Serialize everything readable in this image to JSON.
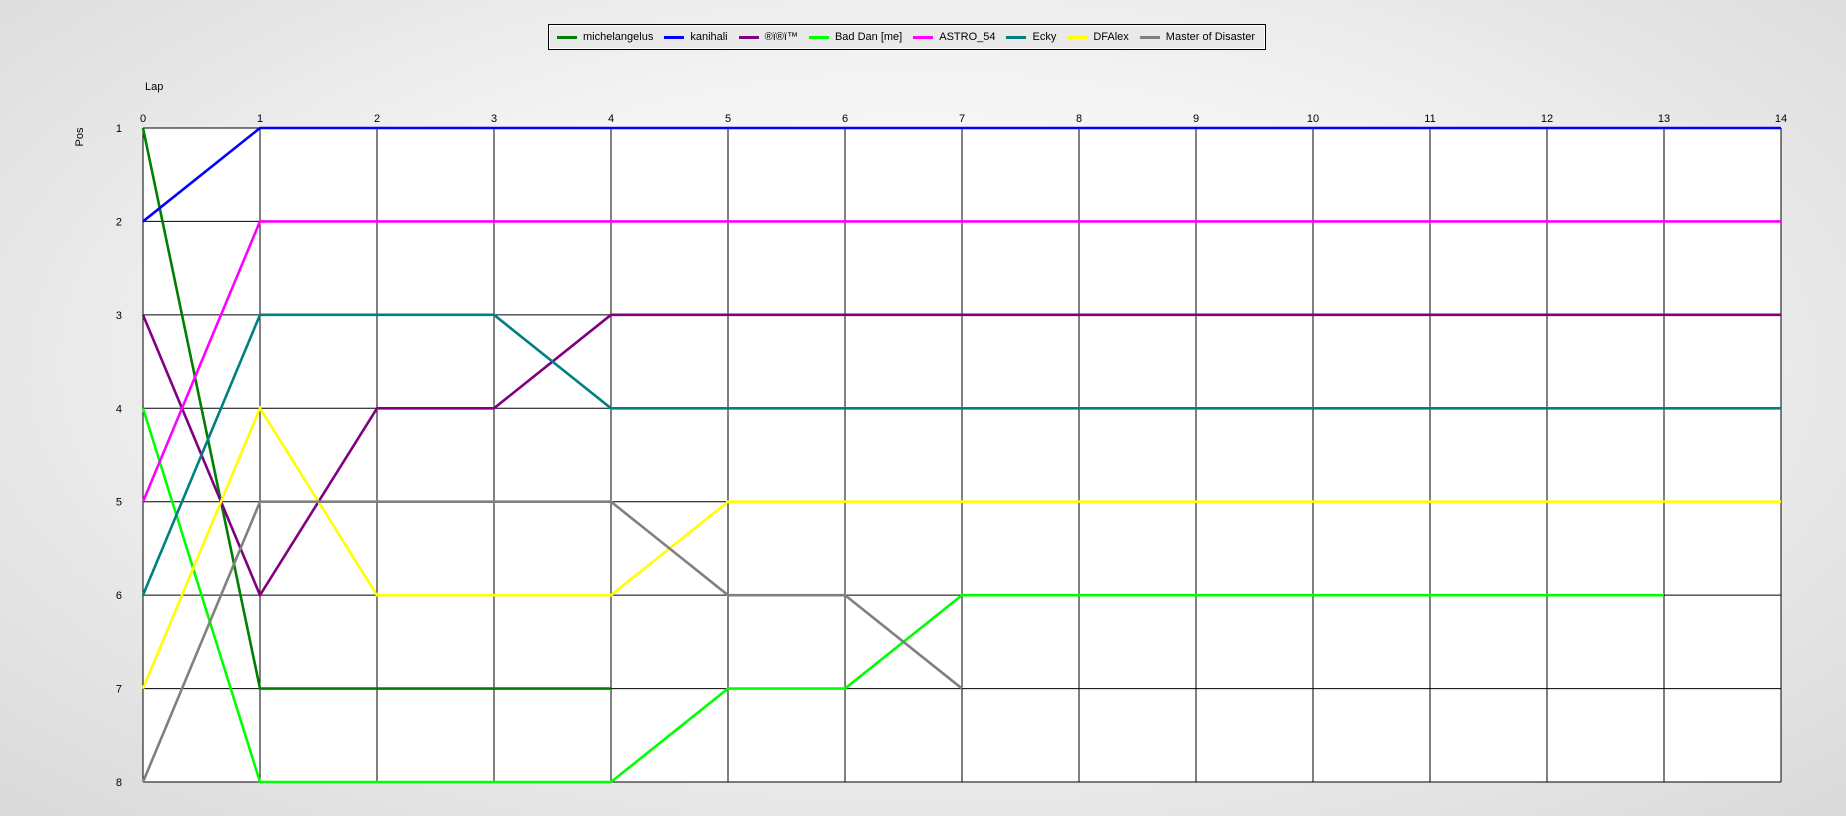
{
  "chart_data": {
    "type": "line",
    "xlabel": "Lap",
    "ylabel": "Pos",
    "x": [
      0,
      1,
      2,
      3,
      4,
      5,
      6,
      7,
      8,
      9,
      10,
      11,
      12,
      13,
      14
    ],
    "xlim": [
      0,
      14
    ],
    "ylim": [
      1,
      8
    ],
    "y_inverted": true,
    "y_ticks": [
      1,
      2,
      3,
      4,
      5,
      6,
      7,
      8
    ],
    "grid": true,
    "legend_position": "top-center",
    "series": [
      {
        "name": "michelangelus",
        "color": "#008000",
        "values": [
          1,
          7,
          7,
          7,
          7
        ]
      },
      {
        "name": "kanihali",
        "color": "#0000ff",
        "values": [
          2,
          1,
          1,
          1,
          1,
          1,
          1,
          1,
          1,
          1,
          1,
          1,
          1,
          1,
          1
        ]
      },
      {
        "name": "®ï®ï™",
        "color": "#800080",
        "values": [
          3,
          6,
          4,
          4,
          3,
          3,
          3,
          3,
          3,
          3,
          3,
          3,
          3,
          3,
          3
        ]
      },
      {
        "name": "Bad Dan [me]",
        "color": "#00ff00",
        "values": [
          4,
          8,
          8,
          8,
          8,
          7,
          7,
          6,
          6,
          6,
          6,
          6,
          6,
          6
        ]
      },
      {
        "name": "ASTRO_54",
        "color": "#ff00ff",
        "values": [
          5,
          2,
          2,
          2,
          2,
          2,
          2,
          2,
          2,
          2,
          2,
          2,
          2,
          2,
          2
        ]
      },
      {
        "name": "Ecky",
        "color": "#008080",
        "values": [
          6,
          3,
          3,
          3,
          4,
          4,
          4,
          4,
          4,
          4,
          4,
          4,
          4,
          4,
          4
        ]
      },
      {
        "name": "DFAlex",
        "color": "#ffff00",
        "values": [
          7,
          4,
          6,
          6,
          6,
          5,
          5,
          5,
          5,
          5,
          5,
          5,
          5,
          5,
          5
        ]
      },
      {
        "name": "Master of Disaster",
        "color": "#808080",
        "values": [
          8,
          5,
          5,
          5,
          5,
          6,
          6,
          7
        ]
      }
    ]
  }
}
